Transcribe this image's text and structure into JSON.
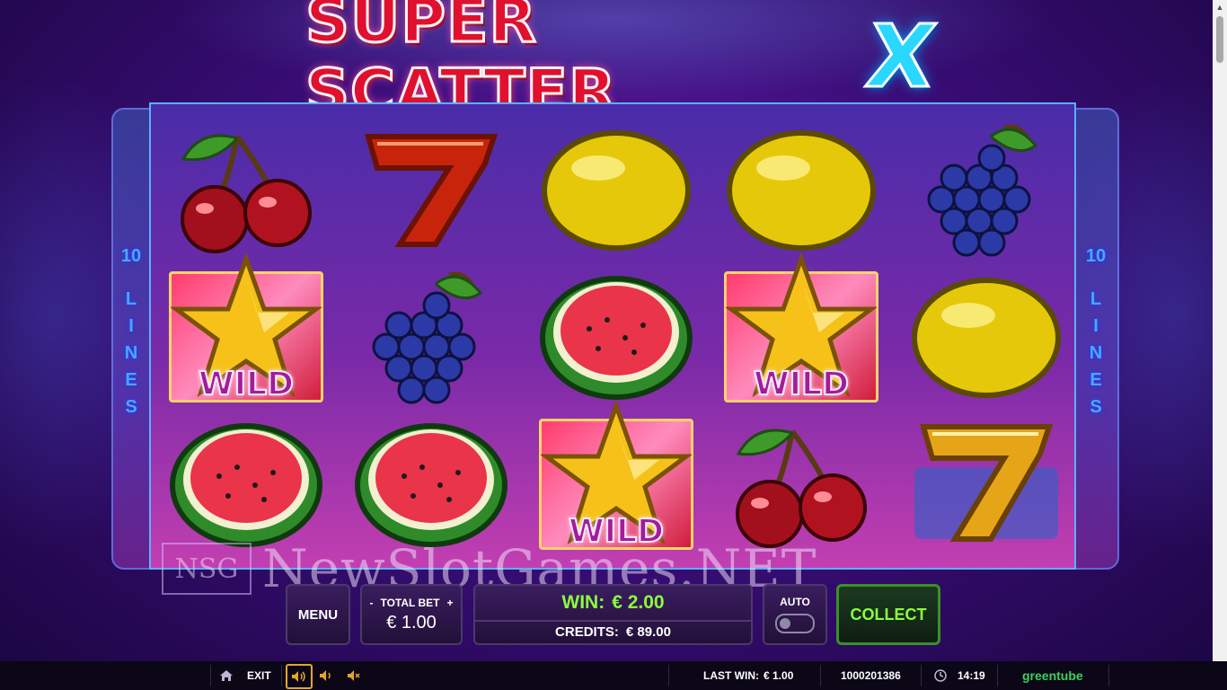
{
  "game": {
    "title_main": "SUPER SCATTER",
    "title_x": "X",
    "lines_number": "10",
    "lines_word": "LINES"
  },
  "reels": [
    [
      "cherry",
      "wild",
      "watermelon"
    ],
    [
      "seven-red",
      "grapes",
      "watermelon"
    ],
    [
      "lemon",
      "watermelon",
      "wild"
    ],
    [
      "lemon",
      "wild",
      "cherry"
    ],
    [
      "grapes",
      "lemon",
      "seven-gold"
    ]
  ],
  "wild_label": "WILD",
  "watermark": {
    "logo": "NSG",
    "text": "NewSlotGames.NET"
  },
  "controls": {
    "menu": "MENU",
    "total_bet_label": "TOTAL BET",
    "minus": "-",
    "plus": "+",
    "total_bet_value": "€ 1.00",
    "win_label": "WIN:",
    "win_value": "€ 2.00",
    "credits_label": "CREDITS:",
    "credits_value": "€ 89.00",
    "auto": "AUTO",
    "collect": "COLLECT"
  },
  "statusbar": {
    "exit": "EXIT",
    "last_win_label": "LAST WIN:",
    "last_win_value": "€ 1.00",
    "session_id": "1000201386",
    "time": "14:19",
    "brand": "greentube"
  },
  "colors": {
    "win_green": "#8bff3c",
    "logo_red": "#e0102e",
    "logo_x_cyan": "#29d7ff",
    "lines_blue": "#49a6ff"
  }
}
